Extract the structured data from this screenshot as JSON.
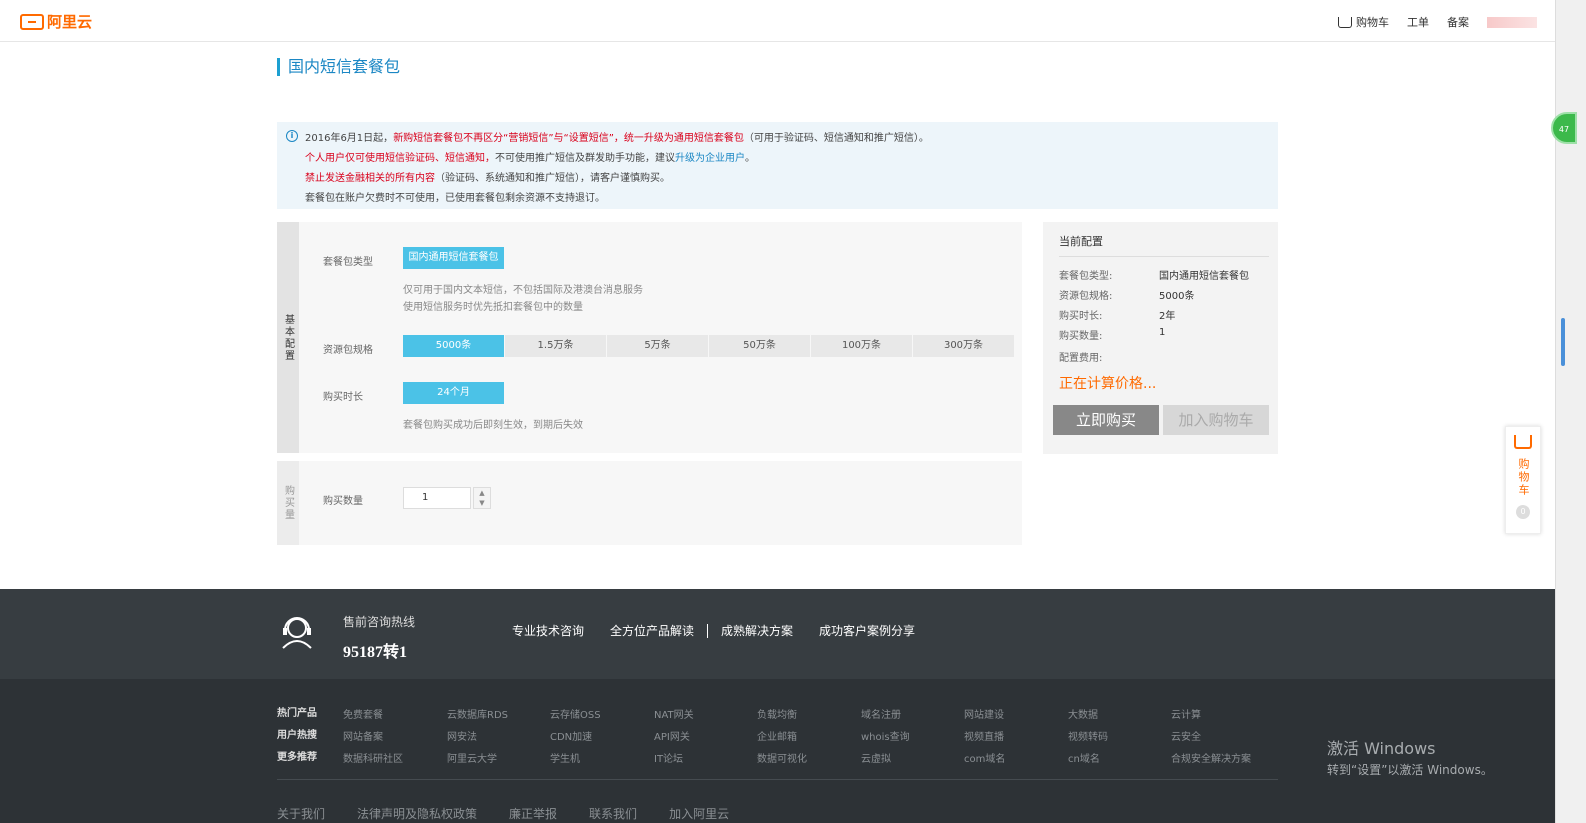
{
  "header": {
    "logo_text": "阿里云",
    "cart": "购物车",
    "ticket": "工单",
    "filing": "备案"
  },
  "title": "国内短信套餐包",
  "notice": {
    "line1_a": "2016年6月1日起，",
    "line1_b": "新购短信套餐包不再区分“营销短信”与“设置短信”，统一升级为通用短信套餐包",
    "line1_c": "（可用于验证码、短信通知和推广短信）。",
    "line2_a": "个人用户仅可使用短信验证码、短信通知，",
    "line2_b": "不可使用推广短信及群发助手功能，建议",
    "line2_c": "升级为企业用户",
    "line2_d": "。",
    "line3_a": "禁止发送金融相关的所有内容",
    "line3_b": "（验证码、系统通知和推广短信），请客户谨慎购买。",
    "line4": "套餐包在账户欠费时不可使用，已使用套餐包剩余资源不支持退订。"
  },
  "basic": {
    "tab": "基本配置",
    "pkg_type_label": "套餐包类型",
    "pkg_type_value": "国内通用短信套餐包",
    "pkg_hint1": "仅可用于国内文本短信，不包括国际及港澳台消息服务",
    "pkg_hint2": "使用短信服务时优先抵扣套餐包中的数量",
    "spec_label": "资源包规格",
    "spec_options": [
      "5000条",
      "1.5万条",
      "5万条",
      "50万条",
      "100万条",
      "300万条"
    ],
    "spec_selected_index": 0,
    "duration_label": "购买时长",
    "duration_value": "24个月",
    "duration_hint": "套餐包购买成功后即刻生效，到期后失效"
  },
  "quantity": {
    "tab": "购买量",
    "label": "购买数量",
    "value": "1"
  },
  "current": {
    "title": "当前配置",
    "rows": [
      {
        "k": "套餐包类型:",
        "v": "国内通用短信套餐包"
      },
      {
        "k": "资源包规格:",
        "v": "5000条"
      },
      {
        "k": "购买时长:",
        "v": "2年"
      },
      {
        "k": "购买数量:",
        "v": "1"
      },
      {
        "k": "配置费用:",
        "v": ""
      }
    ],
    "calculating": "正在计算价格...",
    "buy_now": "立即购买",
    "add_cart": "加入购物车"
  },
  "float_cart": {
    "label": "购物车",
    "count": "0"
  },
  "side_badge": "47",
  "footer": {
    "hotline_label": "售前咨询热线",
    "hotline_number": "95187转1",
    "links": [
      "专业技术咨询",
      "全方位产品解读",
      "成熟解决方案",
      "成功客户案例分享"
    ],
    "categories": [
      {
        "label": "热门产品",
        "items": [
          "免费套餐",
          "云数据库RDS",
          "云存储OSS",
          "NAT网关",
          "负载均衡",
          "域名注册",
          "网站建设",
          "大数据",
          "云计算"
        ]
      },
      {
        "label": "用户热搜",
        "items": [
          "网站备案",
          "网安法",
          "CDN加速",
          "API网关",
          "企业邮箱",
          "whois查询",
          "视频直播",
          "视频转码",
          "云安全"
        ]
      },
      {
        "label": "更多推荐",
        "items": [
          "数据科研社区",
          "阿里云大学",
          "学生机",
          "IT论坛",
          "数据可视化",
          "云虚拟",
          "com域名",
          "cn域名",
          "合规安全解决方案"
        ]
      }
    ],
    "row2": [
      "关于我们",
      "法律声明及隐私权政策",
      "廉正举报",
      "联系我们",
      "加入阿里云"
    ]
  },
  "windows": {
    "line1": "激活 Windows",
    "line2": "转到“设置”以激活 Windows。"
  },
  "colors": {
    "accent_blue": "#4bc2e7",
    "brand_orange": "#ff6a00",
    "notice_red": "#d9001b"
  }
}
